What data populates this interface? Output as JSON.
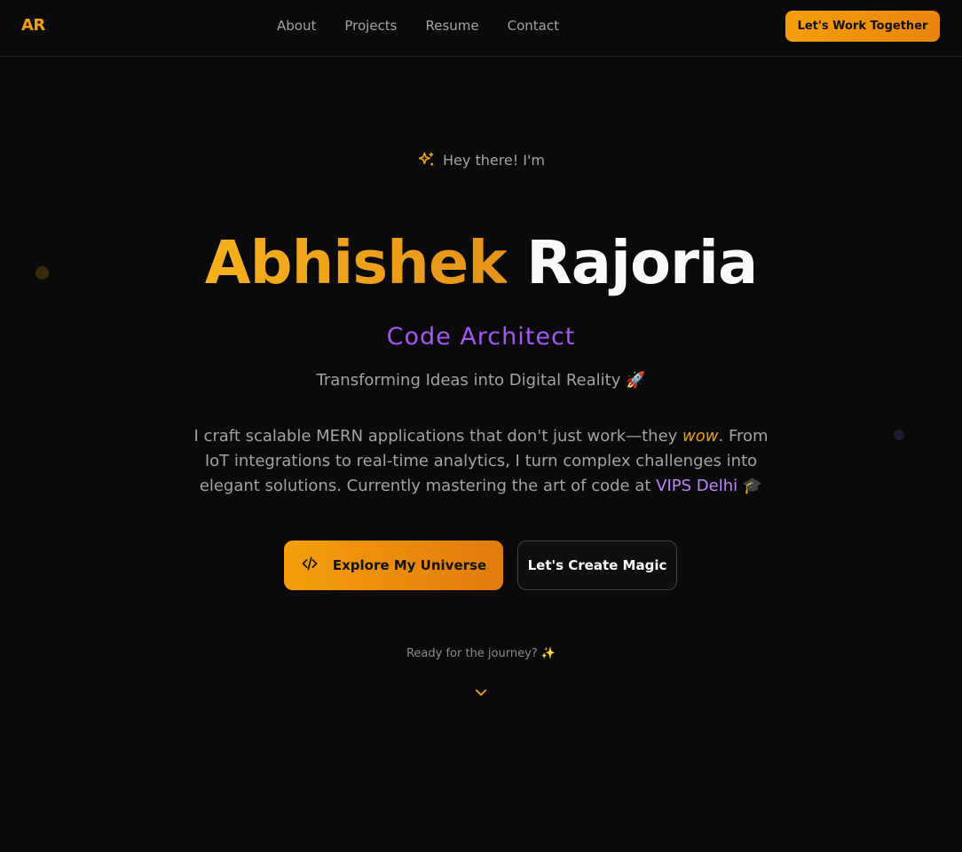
{
  "header": {
    "logo": "AR",
    "nav": [
      "About",
      "Projects",
      "Resume",
      "Contact"
    ],
    "cta_label": "Let's Work Together"
  },
  "hero": {
    "greeting": "Hey there! I'm",
    "first_name": "Abhishek",
    "last_name": "Rajoria",
    "role": "Code Architect",
    "tagline": "Transforming Ideas into Digital Reality 🚀",
    "bio": {
      "part1": "I craft scalable MERN applications that don't just work—they ",
      "emphasis": "wow",
      "part2": ". From IoT integrations to real-time analytics, I turn complex challenges into elegant solutions. Currently mastering the art of code at ",
      "school": "VIPS Delhi",
      "part3": " 🎓"
    },
    "primary_button": "Explore My Universe",
    "secondary_button": "Let's Create Magic",
    "scroll_hint": "Ready for the journey? ✨"
  },
  "colors": {
    "accent": "#f59e0b",
    "purple": "#a855f7",
    "background": "#0a0a0a"
  },
  "icons": {
    "greeting": "sparkles-icon",
    "primary_button": "code-icon",
    "scroll": "chevron-down-icon"
  }
}
